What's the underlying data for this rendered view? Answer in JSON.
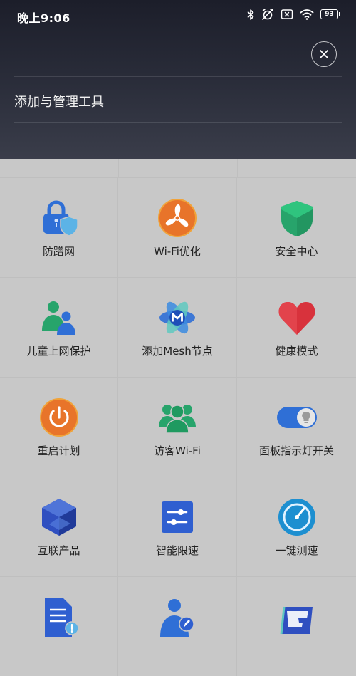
{
  "status_bar": {
    "time": "晚上9:06",
    "battery": "93",
    "icons": [
      "bluetooth-icon",
      "alarm-off-icon",
      "sim-off-icon",
      "wifi-icon",
      "battery-icon"
    ]
  },
  "header": {
    "title": "添加与管理工具",
    "close_icon": "close-icon"
  },
  "tools": [
    {
      "label": "防蹭网",
      "icon": "lock-shield-icon"
    },
    {
      "label": "Wi-Fi优化",
      "icon": "fan-icon"
    },
    {
      "label": "安全中心",
      "icon": "security-shield-icon"
    },
    {
      "label": "儿童上网保护",
      "icon": "child-protection-icon"
    },
    {
      "label": "添加Mesh节点",
      "icon": "mesh-node-icon"
    },
    {
      "label": "健康模式",
      "icon": "heart-icon"
    },
    {
      "label": "重启计划",
      "icon": "power-icon"
    },
    {
      "label": "访客Wi-Fi",
      "icon": "guest-icon"
    },
    {
      "label": "面板指示灯开关",
      "icon": "light-toggle-icon"
    },
    {
      "label": "互联产品",
      "icon": "cube-icon"
    },
    {
      "label": "智能限速",
      "icon": "speed-limit-icon"
    },
    {
      "label": "一键测速",
      "icon": "speedometer-icon"
    },
    {
      "label": "",
      "icon": "document-icon"
    },
    {
      "label": "",
      "icon": "user-edit-icon"
    },
    {
      "label": "",
      "icon": "game-boost-icon"
    }
  ],
  "colors": {
    "overlay_bg": "#c8c8c8",
    "header_bg": "#2b2e3b",
    "accent_blue": "#2f6fd6",
    "accent_green": "#27a46b",
    "accent_red": "#d8323c",
    "accent_orange": "#e8742a"
  }
}
